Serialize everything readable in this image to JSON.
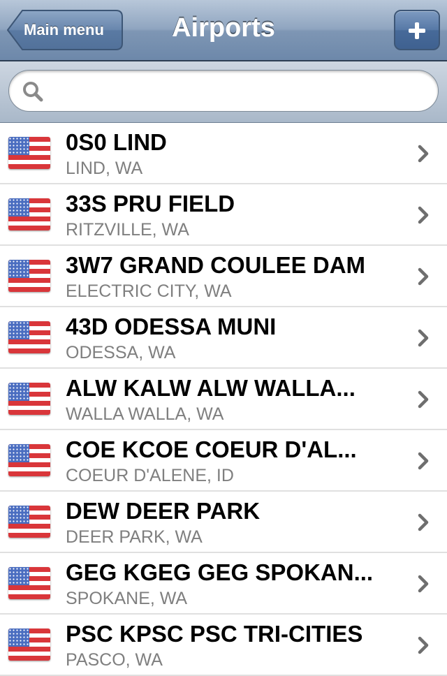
{
  "navbar": {
    "title": "Airports",
    "back_label": "Main menu",
    "add_icon": "plus-icon"
  },
  "search": {
    "value": "",
    "placeholder": "",
    "icon": "search-icon"
  },
  "colors": {
    "navbar": "#7e96b4",
    "subtitle": "#7f7f7f",
    "chevron": "#6e6e6e"
  },
  "airports": [
    {
      "title": "0S0 LIND",
      "subtitle": "LIND, WA",
      "flag": "us-flag-icon"
    },
    {
      "title": "33S PRU FIELD",
      "subtitle": "RITZVILLE, WA",
      "flag": "us-flag-icon"
    },
    {
      "title": "3W7 GRAND COULEE DAM",
      "subtitle": "ELECTRIC CITY, WA",
      "flag": "us-flag-icon"
    },
    {
      "title": "43D ODESSA MUNI",
      "subtitle": "ODESSA, WA",
      "flag": "us-flag-icon"
    },
    {
      "title": "ALW KALW ALW WALLA...",
      "subtitle": "WALLA WALLA, WA",
      "flag": "us-flag-icon"
    },
    {
      "title": "COE KCOE COEUR D'AL...",
      "subtitle": "COEUR D'ALENE, ID",
      "flag": "us-flag-icon"
    },
    {
      "title": "DEW DEER PARK",
      "subtitle": "DEER PARK, WA",
      "flag": "us-flag-icon"
    },
    {
      "title": "GEG KGEG GEG SPOKAN...",
      "subtitle": "SPOKANE, WA",
      "flag": "us-flag-icon"
    },
    {
      "title": "PSC KPSC PSC TRI-CITIES",
      "subtitle": "PASCO, WA",
      "flag": "us-flag-icon"
    }
  ]
}
